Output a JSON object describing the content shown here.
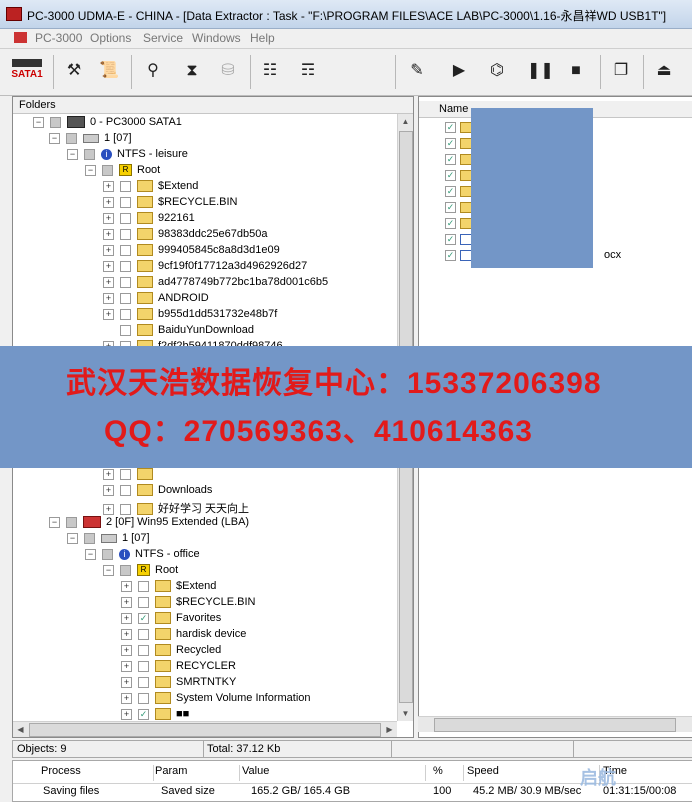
{
  "window": {
    "title": "PC-3000 UDMA-E - CHINA - [Data Extractor : Task - \"F:\\PROGRAM FILES\\ACE LAB\\PC-3000\\1.16-永昌祥WD USB1T\"]"
  },
  "menu": [
    "PC-3000",
    "Options",
    "Service",
    "Windows",
    "Help"
  ],
  "toolbar": {
    "sata_label": "SATA1",
    "buttons": [
      "tools-icon",
      "scroll-icon",
      "binoculars-icon",
      "hourglass-icon",
      "cylinder-icon",
      "tree-a-icon",
      "tree-b-icon",
      "edit-icon",
      "play-icon",
      "network-icon",
      "pause-icon",
      "stop-icon",
      "windows-icon",
      "exit-icon"
    ]
  },
  "folders_panel": {
    "header": "Folders"
  },
  "tree": [
    {
      "label": "0 - PC3000 SATA1",
      "type": "hdd",
      "exp": "−"
    },
    {
      "label": "1 [07]",
      "type": "disk",
      "exp": "−"
    },
    {
      "label": "NTFS - leisure",
      "type": "info",
      "exp": "−"
    },
    {
      "label": "Root",
      "type": "root",
      "exp": "−"
    },
    {
      "label": "$Extend",
      "type": "folder",
      "exp": "+"
    },
    {
      "label": "$RECYCLE.BIN",
      "type": "folder",
      "exp": "+"
    },
    {
      "label": "922161",
      "type": "folder",
      "exp": "+"
    },
    {
      "label": "98383ddc25e67db50a",
      "type": "folder",
      "exp": "+"
    },
    {
      "label": "999405845c8a8d3d1e09",
      "type": "folder",
      "exp": "+"
    },
    {
      "label": "9cf19f0f17712a3d4962926d27",
      "type": "folder",
      "exp": "+"
    },
    {
      "label": "ad4778749b772bc1ba78d001c6b5",
      "type": "folder",
      "exp": "+"
    },
    {
      "label": "ANDROID",
      "type": "folder",
      "exp": "+"
    },
    {
      "label": "b955d1dd531732e48b7f",
      "type": "folder",
      "exp": "+"
    },
    {
      "label": "BaiduYunDownload",
      "type": "folder",
      "exp": ""
    },
    {
      "label": "f2df2b59411870ddf98746",
      "type": "folder",
      "exp": "+"
    }
  ],
  "tree_bottom": [
    {
      "label": "",
      "type": "folder",
      "exp": "+"
    },
    {
      "label": "Downloads",
      "type": "folder",
      "exp": "+"
    },
    {
      "label": "好好学习 天天向上",
      "type": "folder",
      "exp": "+"
    },
    {
      "label": "2 [0F] Win95 Extended  (LBA)",
      "type": "part",
      "exp": "−"
    },
    {
      "label": "1 [07]",
      "type": "disk",
      "exp": "−"
    },
    {
      "label": "NTFS - office",
      "type": "info",
      "exp": "−"
    },
    {
      "label": "Root",
      "type": "root",
      "exp": "−"
    },
    {
      "label": "$Extend",
      "type": "folder",
      "exp": "+"
    },
    {
      "label": "$RECYCLE.BIN",
      "type": "folder",
      "exp": "+"
    },
    {
      "label": "Favorites",
      "type": "folder",
      "exp": "+",
      "checked": true
    },
    {
      "label": "hardisk device",
      "type": "folder",
      "exp": "+"
    },
    {
      "label": "Recycled",
      "type": "folder",
      "exp": "+"
    },
    {
      "label": "RECYCLER",
      "type": "folder",
      "exp": "+"
    },
    {
      "label": "SMRTNTKY",
      "type": "folder",
      "exp": "+"
    },
    {
      "label": "System Volume Information",
      "type": "folder",
      "exp": "+"
    },
    {
      "label": "■■",
      "type": "folder",
      "exp": "+",
      "checked": true
    }
  ],
  "files_panel": {
    "column": "Name",
    "rows": [
      {
        "type": "folder",
        "label": ""
      },
      {
        "type": "folder",
        "label": ""
      },
      {
        "type": "folder",
        "label": ""
      },
      {
        "type": "folder",
        "label": ""
      },
      {
        "type": "folder",
        "label": ""
      },
      {
        "type": "folder",
        "label": ""
      },
      {
        "type": "folder",
        "label": ""
      },
      {
        "type": "doc",
        "label": ""
      },
      {
        "type": "doc",
        "label": "ocx"
      }
    ]
  },
  "banner": {
    "line1": "武汉天浩数据恢复中心：15337206398",
    "line2": "QQ：270569363、410614363"
  },
  "status": {
    "objects": "Objects: 9",
    "total": "Total: 37.12 Kb"
  },
  "progress": {
    "headers": [
      "Process",
      "Param",
      "Value",
      "%",
      "Speed",
      "Time"
    ],
    "values": [
      "Saving files",
      "Saved size",
      "165.2 GB/ 165.4 GB",
      "100",
      "45.2 MB/ 30.9 MB/sec",
      "01:31:15/00:08"
    ]
  },
  "watermark": "启航"
}
